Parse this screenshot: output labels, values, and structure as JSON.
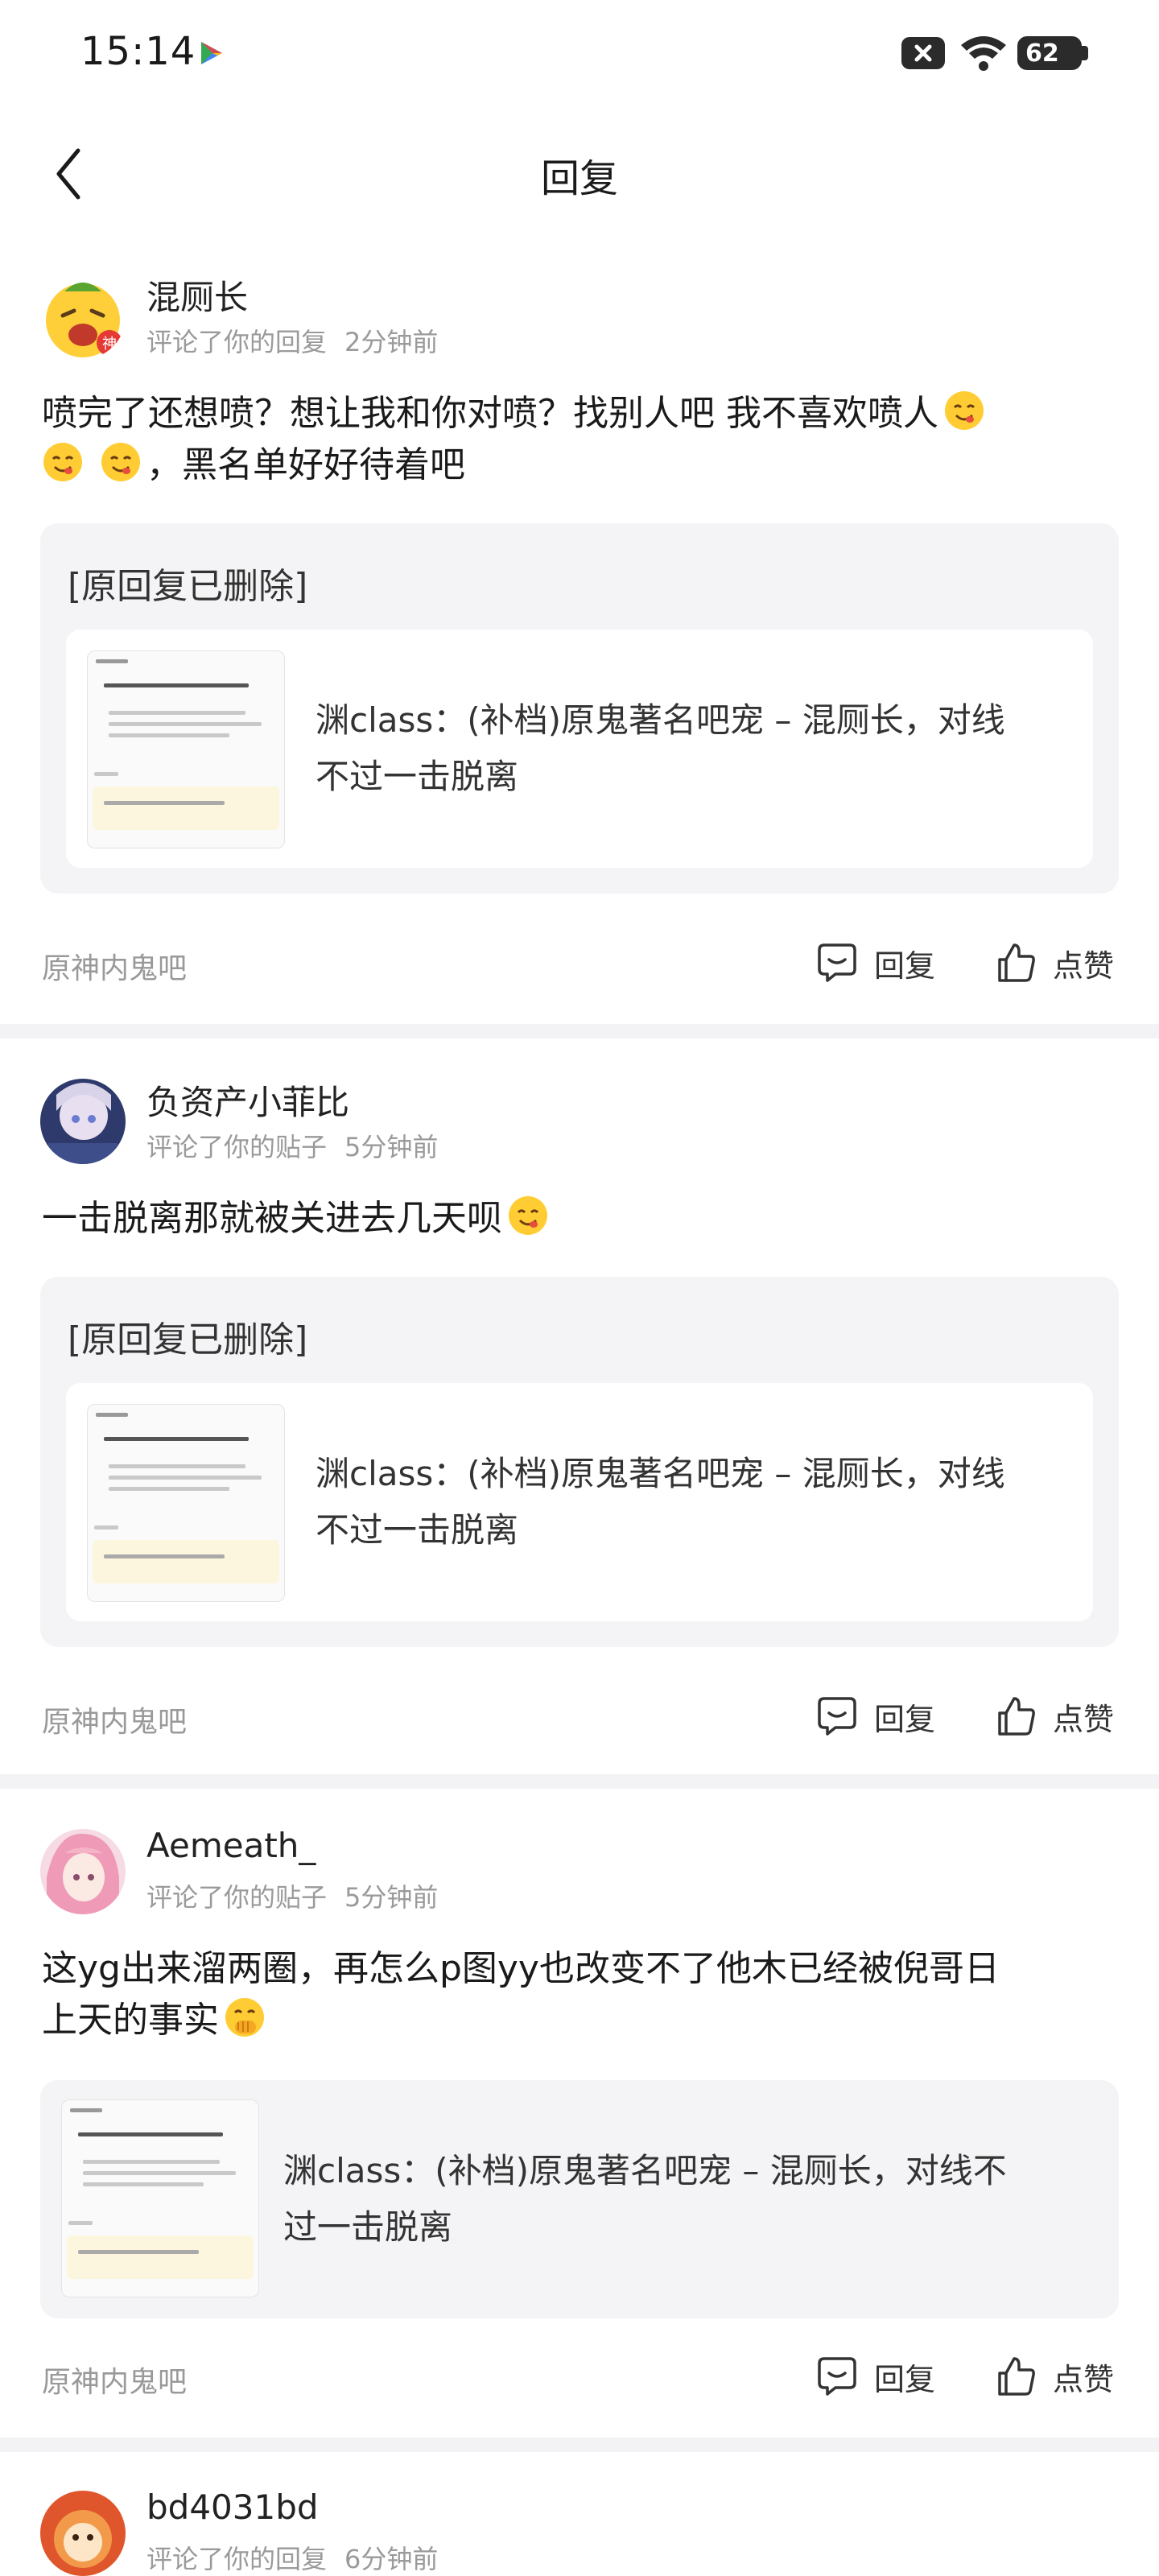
{
  "status_bar": {
    "time": "15:14",
    "battery": "62"
  },
  "header": {
    "title": "回复"
  },
  "items": [
    {
      "username": "混厕长",
      "action": "评论了你的回复",
      "time": "2分钟前",
      "content_line1": "喷完了还想喷？想让我和你对喷？找别人吧 我不喜欢喷人",
      "content_line2": "，黑名单好好待着吧",
      "quote_deleted": "[原回复已删除]",
      "post_line1": "渊class：(补档)原鬼著名吧宠 – 混厕长，对线",
      "post_line2": "不过一击脱离",
      "forum": "原神内鬼吧",
      "reply_label": "回复",
      "like_label": "点赞"
    },
    {
      "username": "负资产小菲比",
      "action": "评论了你的贴子",
      "time": "5分钟前",
      "content_line1": "一击脱离那就被关进去几天呗",
      "quote_deleted": "[原回复已删除]",
      "post_line1": "渊class：(补档)原鬼著名吧宠 – 混厕长，对线",
      "post_line2": "不过一击脱离",
      "forum": "原神内鬼吧",
      "reply_label": "回复",
      "like_label": "点赞"
    },
    {
      "username": "Aemeath_",
      "action": "评论了你的贴子",
      "time": "5分钟前",
      "content_line1": "这yg出来溜两圈，再怎么p图yy也改变不了他木已经被倪哥日",
      "content_line2": "上天的事实",
      "post_line1": "渊class：(补档)原鬼著名吧宠 – 混厕长，对线不",
      "post_line2": "过一击脱离",
      "forum": "原神内鬼吧",
      "reply_label": "回复",
      "like_label": "点赞"
    },
    {
      "username": "bd4031bd",
      "action": "评论了你的回复",
      "time": "6分钟前"
    }
  ],
  "icons": {
    "back": "chevron-left-icon",
    "reply": "comment-bubble-icon",
    "like": "thumbs-up-icon",
    "emoji_yum": "yum-face-emoji",
    "emoji_hush": "hand-over-mouth-emoji"
  },
  "colors": {
    "background": "#ffffff",
    "quote_bg": "#f4f4f6",
    "meta_text": "#9a9a9a",
    "divider": "#f3f3f5"
  }
}
